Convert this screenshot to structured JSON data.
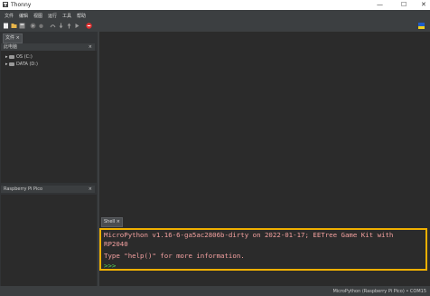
{
  "window": {
    "title": "Thonny",
    "controls": [
      "—",
      "☐",
      "✕"
    ]
  },
  "menu": [
    "文件",
    "编辑",
    "视图",
    "运行",
    "工具",
    "帮助"
  ],
  "toolbar": {
    "icons": [
      "new-file-icon",
      "open-icon",
      "save-icon",
      "run-icon",
      "debug-icon",
      "step-over-icon",
      "step-into-icon",
      "step-out-icon",
      "resume-icon",
      "stop-icon"
    ],
    "stop_color": "#e03030"
  },
  "left_tabs": {
    "files_tab": "文件 ×"
  },
  "files_panel": {
    "header": "此电脑",
    "close": "×",
    "items": [
      {
        "caret": "▸",
        "label": "OS (C:)"
      },
      {
        "caret": "▸",
        "label": "DATA (D:)"
      }
    ]
  },
  "pico_panel": {
    "header": "Raspberry Pi Pico",
    "close": "×"
  },
  "shell": {
    "tab": "Shell ×",
    "line1": "MicroPython v1.16-6-ga5ac2806b-dirty on 2022-01-17; EETree Game Kit with",
    "line2": "RP2040",
    "line3": "Type \"help()\" for more information.",
    "prompt": ">>>",
    "highlight_color": "#f0b000"
  },
  "status": {
    "text": "MicroPython (Raspberry Pi Pico)  •  COM15"
  }
}
